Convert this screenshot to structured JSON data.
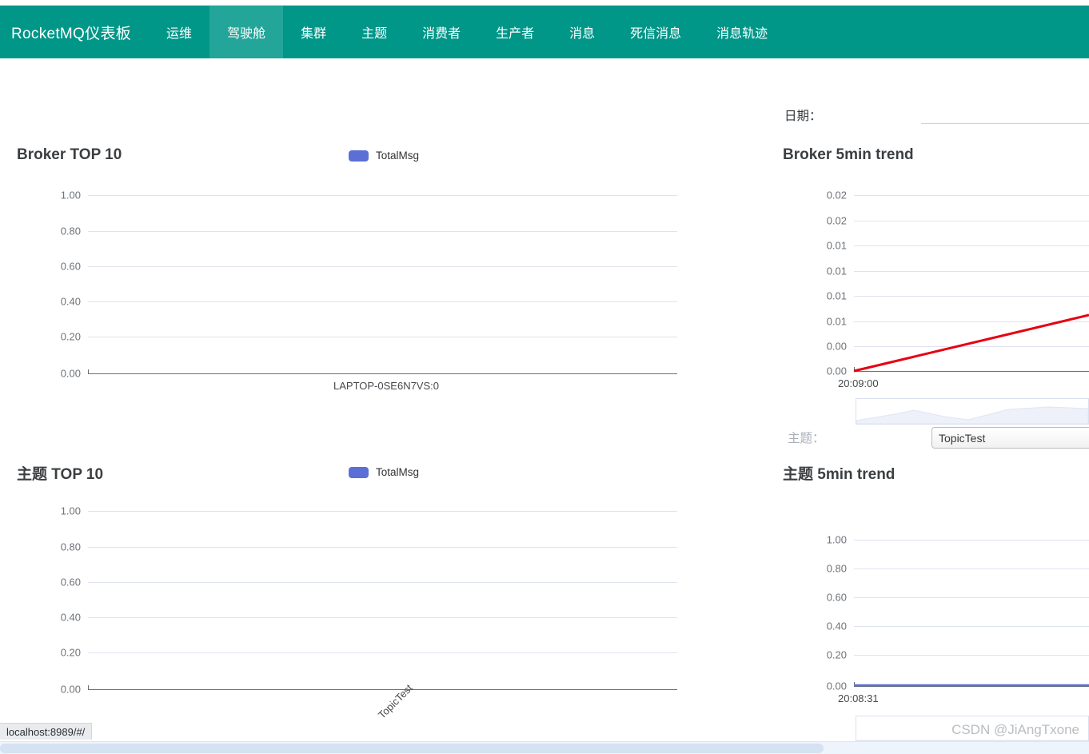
{
  "navbar": {
    "brand": "RocketMQ仪表板",
    "items": [
      {
        "label": "运维",
        "active": false
      },
      {
        "label": "驾驶舱",
        "active": true
      },
      {
        "label": "集群",
        "active": false
      },
      {
        "label": "主题",
        "active": false
      },
      {
        "label": "消费者",
        "active": false
      },
      {
        "label": "生产者",
        "active": false
      },
      {
        "label": "消息",
        "active": false
      },
      {
        "label": "死信消息",
        "active": false
      },
      {
        "label": "消息轨迹",
        "active": false
      }
    ],
    "brand_color": "#009688",
    "active_color": "#24a599"
  },
  "controls": {
    "date_label": "日期：",
    "date_value": "",
    "date_placeholder": "",
    "topic_label": "主题：",
    "topic_value": "TopicTest",
    "topic_options": [
      "TopicTest"
    ]
  },
  "legend": {
    "label": "TotalMsg",
    "color": "#5b6fd6"
  },
  "statusbar": {
    "url": "localhost:8989/#/"
  },
  "watermark": {
    "text": "CSDN @JiAngTxone"
  },
  "chart_data": [
    {
      "id": "broker-top10",
      "type": "bar",
      "title": "Broker TOP 10",
      "categories": [
        "LAPTOP-0SE6N7VS:0"
      ],
      "series": [
        {
          "name": "TotalMsg",
          "values": [
            0
          ]
        }
      ],
      "yticks": [
        "1.00",
        "0.80",
        "0.60",
        "0.40",
        "0.20",
        "0.00"
      ],
      "ylim": [
        0,
        1
      ],
      "xlabel": "",
      "ylabel": "",
      "grid": true,
      "legend_position": "top-center"
    },
    {
      "id": "broker-5min-trend",
      "type": "line",
      "title": "Broker 5min trend",
      "x": [
        "20:09:00"
      ],
      "series": [
        {
          "name": "TotalMsg",
          "color": "#e60012",
          "values": [
            0.0
          ]
        }
      ],
      "yticks": [
        "0.02",
        "0.02",
        "0.01",
        "0.01",
        "0.01",
        "0.01",
        "0.00",
        "0.00"
      ],
      "ylim": [
        0,
        0.02
      ],
      "xlabel": "",
      "ylabel": "",
      "grid": true,
      "datazoom": true
    },
    {
      "id": "topic-top10",
      "type": "bar",
      "title": "主题 TOP 10",
      "categories": [
        "TopicTest"
      ],
      "series": [
        {
          "name": "TotalMsg",
          "values": [
            0
          ]
        }
      ],
      "yticks": [
        "1.00",
        "0.80",
        "0.60",
        "0.40",
        "0.20",
        "0.00"
      ],
      "ylim": [
        0,
        1
      ],
      "xlabel": "",
      "ylabel": "",
      "grid": true,
      "legend_position": "top-center"
    },
    {
      "id": "topic-5min-trend",
      "type": "line",
      "title": "主题 5min trend",
      "x": [
        "20:08:31"
      ],
      "series": [
        {
          "name": "TotalMsg",
          "color": "#5b6fd6",
          "values": [
            0.0
          ]
        }
      ],
      "yticks": [
        "1.00",
        "0.80",
        "0.60",
        "0.40",
        "0.20",
        "0.00"
      ],
      "ylim": [
        0,
        1
      ],
      "xlabel": "",
      "ylabel": "",
      "grid": true,
      "datazoom": true
    }
  ]
}
